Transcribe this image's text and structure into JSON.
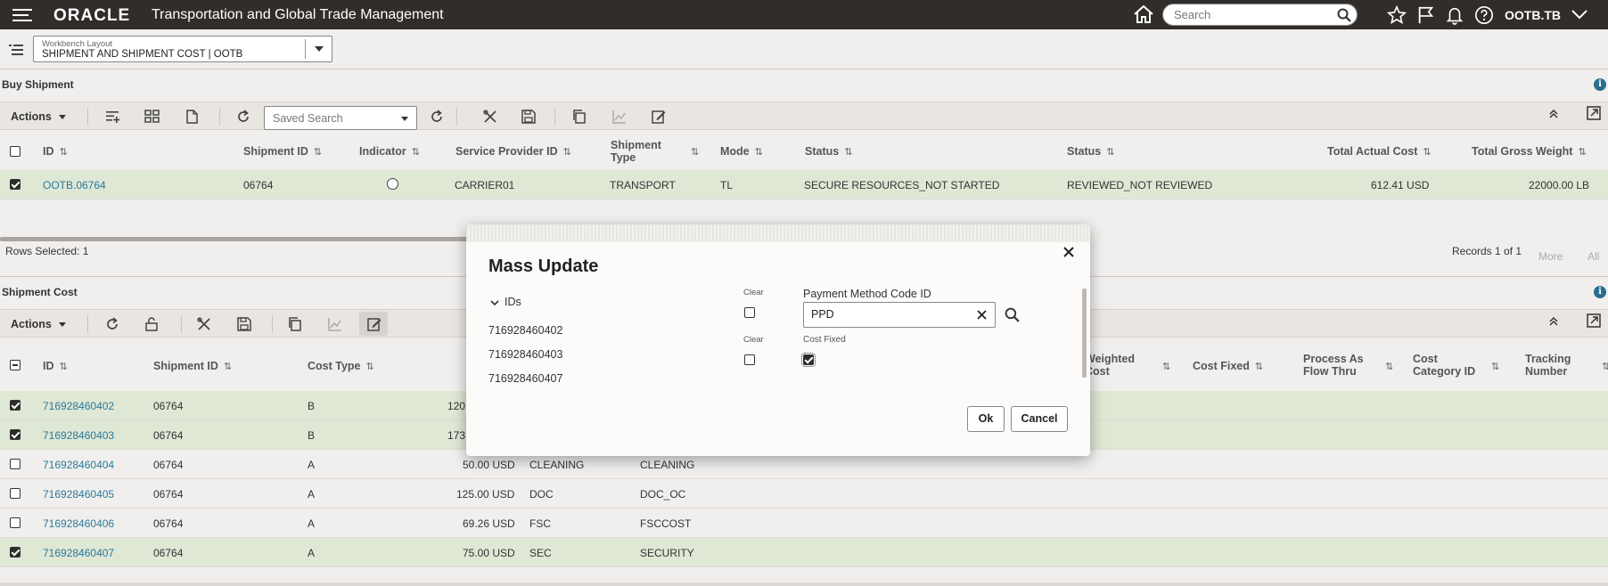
{
  "header": {
    "logo": "ORACLE",
    "app_title": "Transportation and Global Trade Management",
    "search_placeholder": "Search",
    "user": "OOTB.TB"
  },
  "layout": {
    "label": "Workbench Layout",
    "value": "SHIPMENT AND SHIPMENT COST | OOTB"
  },
  "buy_shipment": {
    "title": "Buy Shipment",
    "actions_label": "Actions",
    "saved_search_placeholder": "Saved Search",
    "columns": [
      "ID",
      "Shipment ID",
      "Indicator",
      "Service Provider ID",
      "Shipment Type",
      "Mode",
      "Status",
      "Status",
      "Total Actual Cost",
      "Total Gross Weight"
    ],
    "rows": [
      {
        "id": "OOTB.06764",
        "shipment_id": "06764",
        "service_provider": "CARRIER01",
        "shipment_type": "TRANSPORT",
        "mode": "TL",
        "status1": "SECURE RESOURCES_NOT STARTED",
        "status2": "REVIEWED_NOT REVIEWED",
        "total_cost": "612.41 USD",
        "gross_weight": "22000.00 LB"
      }
    ],
    "rows_selected": "Rows Selected: 1",
    "records": "Records 1 of 1",
    "more": "More",
    "all": "All"
  },
  "shipment_cost": {
    "title": "Shipment Cost",
    "actions_label": "Actions",
    "columns": {
      "id": "ID",
      "shipment_id": "Shipment ID",
      "cost_type": "Cost Type",
      "weighted_cost_1": "Weighted",
      "weighted_cost_2": "Cost",
      "cost_fixed": "Cost Fixed",
      "process_flow_1": "Process As",
      "process_flow_2": "Flow Thru",
      "cost_category_1": "Cost",
      "cost_category_2": "Category ID",
      "tracking_1": "Tracking",
      "tracking_2": "Number"
    },
    "rows": [
      {
        "id": "716928460402",
        "shipment_id": "06764",
        "cost_type": "B",
        "cost": "120",
        "accessorial": "",
        "description": "",
        "checked": true
      },
      {
        "id": "716928460403",
        "shipment_id": "06764",
        "cost_type": "B",
        "cost": "173",
        "accessorial": "",
        "description": "",
        "checked": true
      },
      {
        "id": "716928460404",
        "shipment_id": "06764",
        "cost_type": "A",
        "cost": "50.00 USD",
        "accessorial": "CLEANING",
        "description": "CLEANING",
        "checked": false
      },
      {
        "id": "716928460405",
        "shipment_id": "06764",
        "cost_type": "A",
        "cost": "125.00 USD",
        "accessorial": "DOC",
        "description": "DOC_OC",
        "checked": false
      },
      {
        "id": "716928460406",
        "shipment_id": "06764",
        "cost_type": "A",
        "cost": "69.26 USD",
        "accessorial": "FSC",
        "description": "FSCCOST",
        "checked": false
      },
      {
        "id": "716928460407",
        "shipment_id": "06764",
        "cost_type": "A",
        "cost": "75.00 USD",
        "accessorial": "SEC",
        "description": "SECURITY",
        "checked": true
      }
    ]
  },
  "dialog": {
    "title": "Mass Update",
    "ids_label": "IDs",
    "ids": [
      "716928460402",
      "716928460403",
      "716928460407"
    ],
    "clear_label": "Clear",
    "payment_label": "Payment Method Code ID",
    "payment_value": "PPD",
    "cost_fixed_label": "Cost Fixed",
    "ok": "Ok",
    "cancel": "Cancel"
  }
}
